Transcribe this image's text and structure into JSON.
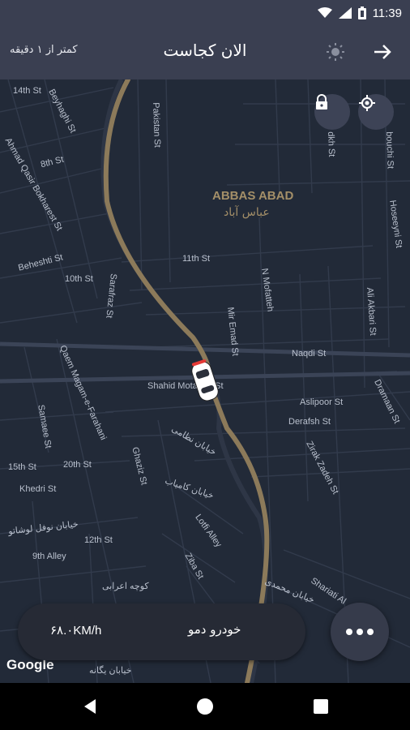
{
  "status_bar": {
    "time": "11:39",
    "icons": [
      "wifi-icon",
      "signal-icon",
      "battery-icon"
    ]
  },
  "header": {
    "title": "الان کجاست",
    "subtitle": "کمتر از ۱ دقیقه",
    "icons": [
      "back-arrow-icon",
      "brightness-icon"
    ]
  },
  "map": {
    "district_en": "ABBAS ABAD",
    "district_fa": "عباس آباد",
    "streets": [
      "14th St",
      "Beyhaghi St",
      "Pakistan St",
      "8th St",
      "Ahmad Qasir Bokharest St",
      "Beheshti St",
      "11th St",
      "10th St",
      "Sarafraz St",
      "N Mofatteh",
      "Mir Emad St",
      "Naqdi St",
      "Shahid Motahari St",
      "Aslipoor St",
      "Derafsh St",
      "Qaem Magam-e-Farahani",
      "Samaee St",
      "15th St",
      "20th St",
      "Khedri St",
      "Ghaziz St",
      "12th St",
      "9th Alley",
      "Lotfi Alley",
      "Ziba St",
      "Shariati Al",
      "Zirak Zadeh St",
      "Dramaan St",
      "Ali Akbari St",
      "Hoseeyni St",
      "bouchi St",
      "dkh St",
      "خیابان نظامی",
      "خیابان کامیاب",
      "خیابان نوفل لوشاتو",
      "کوچه اعرابی",
      "خیابان محمدی",
      "خیابان یگانه"
    ],
    "attribution": "Google",
    "icons": [
      "lock-icon",
      "my-location-icon",
      "car-marker-icon"
    ]
  },
  "vehicle_panel": {
    "speed": "۶۸.۰KM/h",
    "vehicle_name": "خودرو دمو"
  },
  "more_button": {
    "icon": "more-dots-icon"
  },
  "nav_bar": {
    "icons": [
      "back-nav-icon",
      "home-nav-icon",
      "recents-nav-icon"
    ]
  },
  "colors": {
    "appbar": "#3a3f51",
    "map_bg": "#222a38",
    "route": "#8c7a5a",
    "panel": "#262a35"
  }
}
